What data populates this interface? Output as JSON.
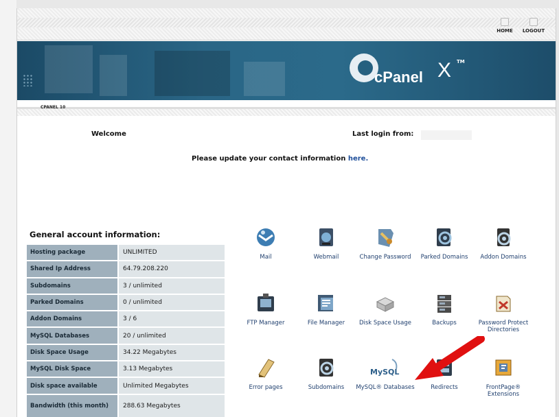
{
  "topnav": {
    "home_label": "HOME",
    "logout_label": "LOGOUT"
  },
  "banner": {
    "logo_text": "cPanel",
    "logo_x": "X",
    "logo_tm": "TM"
  },
  "breadcrumb": "CPANEL 10",
  "welcome": {
    "welcome_label": "Welcome",
    "last_login_label": "Last login from:",
    "update_text": "Please update your contact information",
    "update_link": "here."
  },
  "account": {
    "title": "General account information:",
    "rows": [
      {
        "label": "Hosting package",
        "value": "UNLIMITED"
      },
      {
        "label": "Shared Ip Address",
        "value": "64.79.208.220"
      },
      {
        "label": "Subdomains",
        "value": "3 / unlimited"
      },
      {
        "label": "Parked Domains",
        "value": "0 / unlimited"
      },
      {
        "label": "Addon Domains",
        "value": "3 / 6"
      },
      {
        "label": "MySQL Databases",
        "value": "20 / unlimited"
      },
      {
        "label": "Disk Space Usage",
        "value": "34.22 Megabytes"
      },
      {
        "label": "MySQL Disk Space",
        "value": "3.13 Megabytes"
      },
      {
        "label": "Disk space available",
        "value": "Unlimited Megabytes"
      },
      {
        "label": "Bandwidth (this month)",
        "value": "288.63 Megabytes"
      }
    ]
  },
  "icons": [
    {
      "label": "Mail",
      "icon": "mail-icon"
    },
    {
      "label": "Webmail",
      "icon": "webmail-icon"
    },
    {
      "label": "Change Password",
      "icon": "change-password-icon"
    },
    {
      "label": "Parked Domains",
      "icon": "parked-domains-icon"
    },
    {
      "label": "Addon Domains",
      "icon": "addon-domains-icon"
    },
    {
      "label": "FTP Manager",
      "icon": "ftp-manager-icon"
    },
    {
      "label": "File Manager",
      "icon": "file-manager-icon"
    },
    {
      "label": "Disk Space Usage",
      "icon": "disk-space-icon"
    },
    {
      "label": "Backups",
      "icon": "backups-icon"
    },
    {
      "label": "Password Protect Directories",
      "icon": "password-protect-icon"
    },
    {
      "label": "Error pages",
      "icon": "error-pages-icon"
    },
    {
      "label": "Subdomains",
      "icon": "subdomains-icon"
    },
    {
      "label": "MySQL® Databases",
      "icon": "mysql-icon",
      "logo_text": "MySQL"
    },
    {
      "label": "Redirects",
      "icon": "redirects-icon"
    },
    {
      "label": "FrontPage® Extensions",
      "icon": "frontpage-icon"
    }
  ],
  "colors": {
    "banner": "#2a6686",
    "table_key_bg": "#9fb0bc",
    "table_value_bg": "#dfe5e8",
    "link": "#1f4f9a",
    "arrow": "#e01010"
  }
}
